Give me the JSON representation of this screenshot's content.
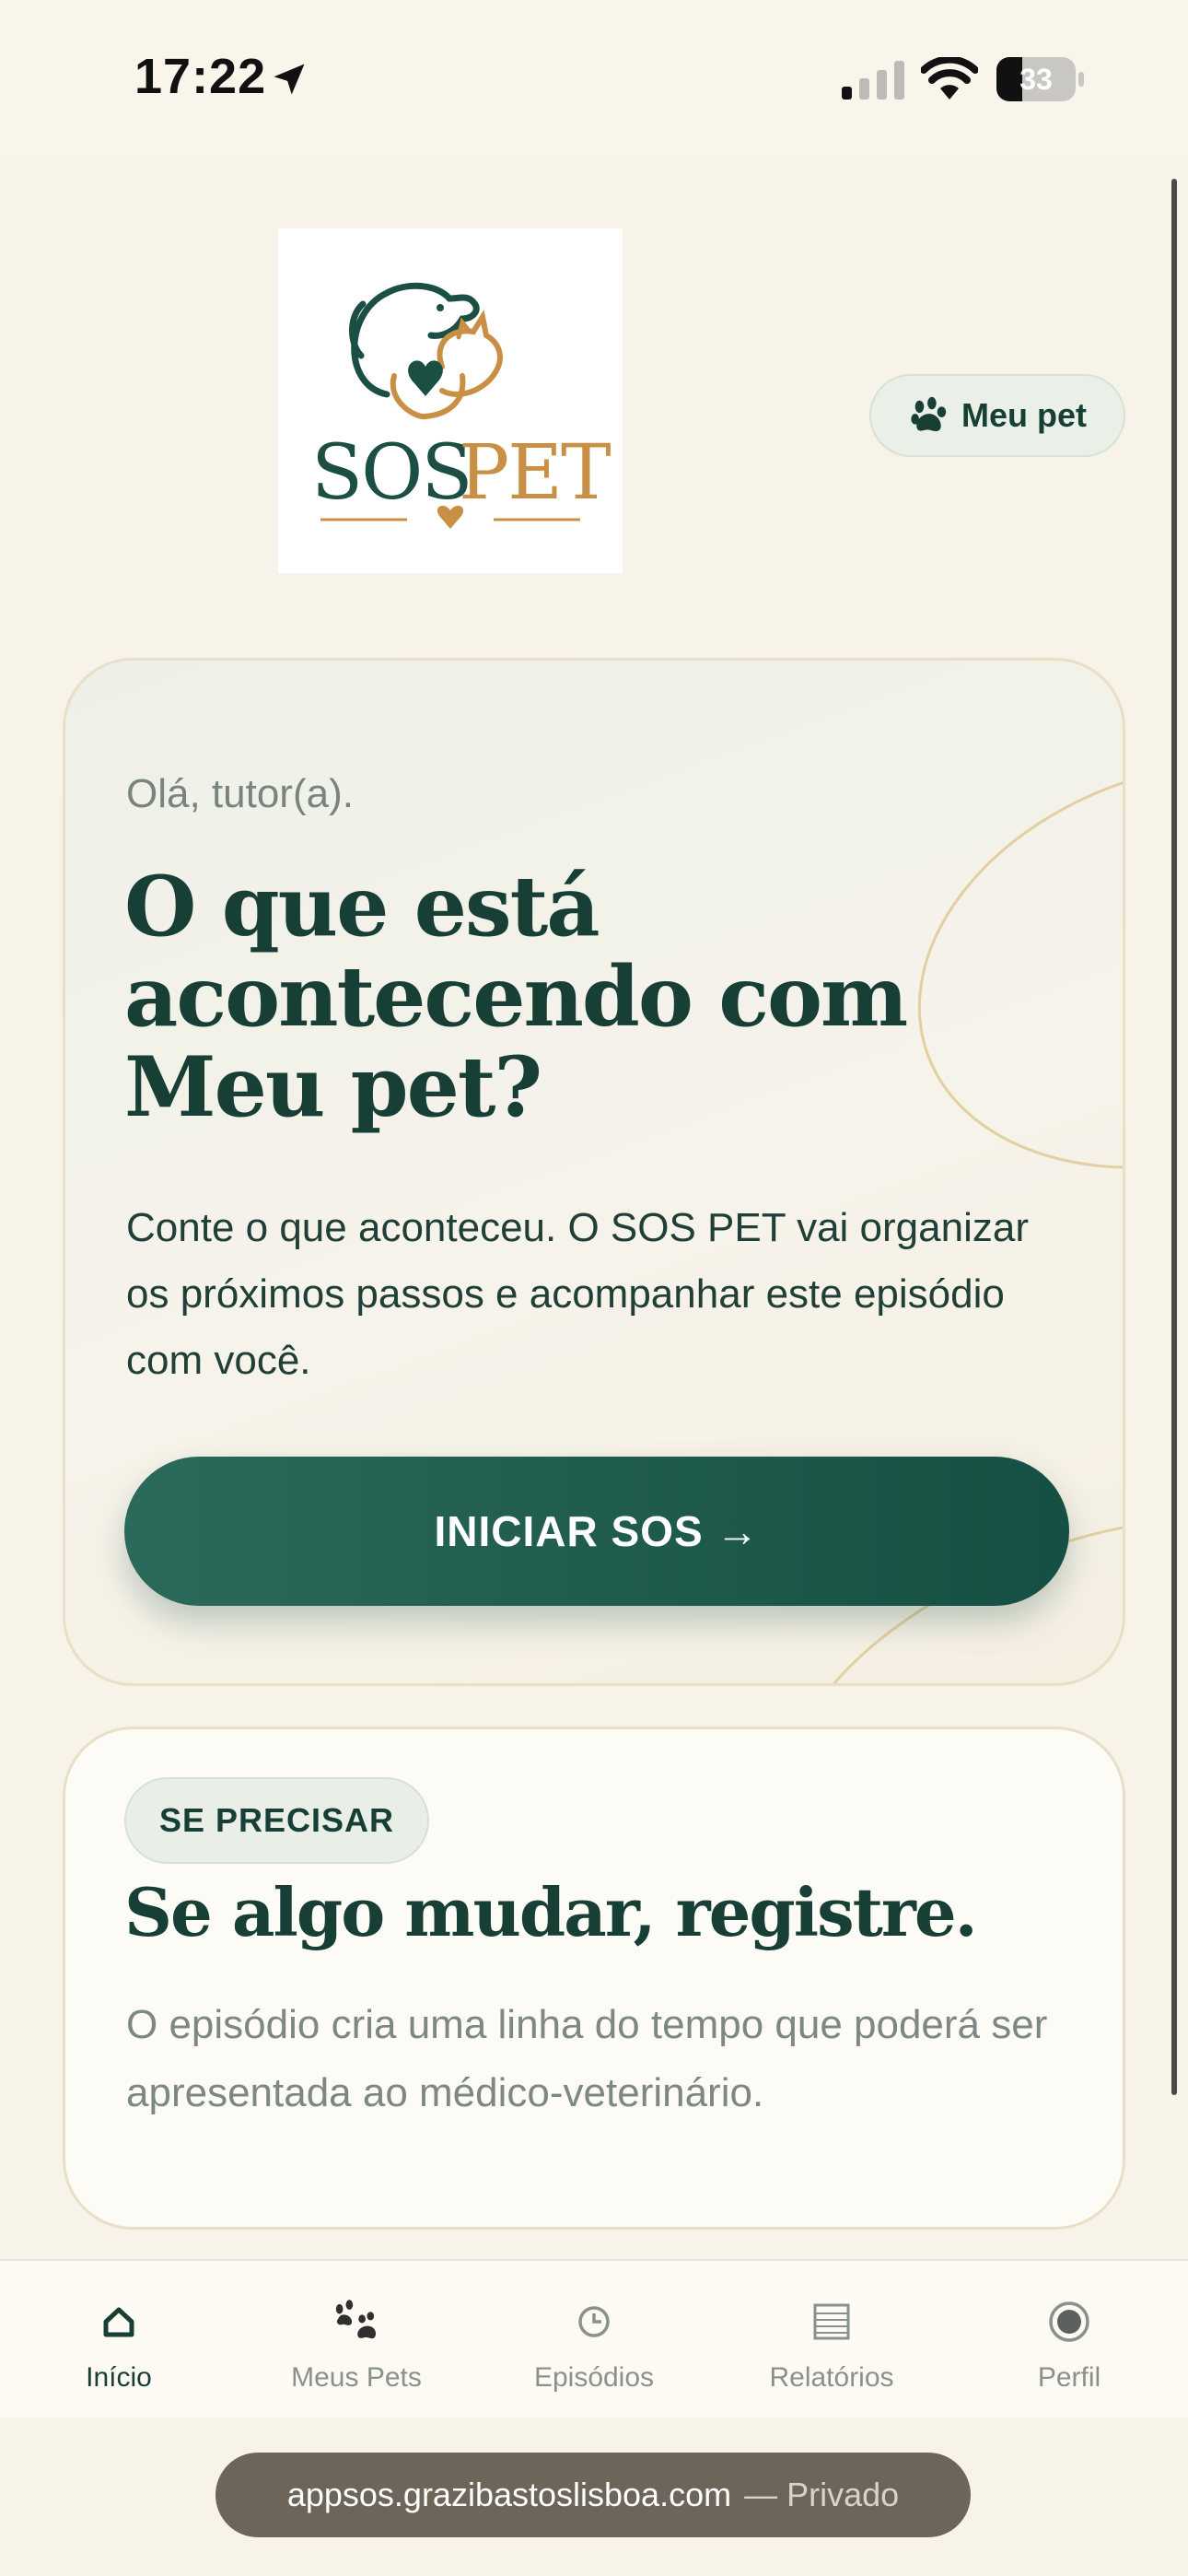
{
  "status_bar": {
    "time": "17:22",
    "battery": "33",
    "battery_level": 0.33
  },
  "header": {
    "meu_pet_label": "Meu pet"
  },
  "logo": {
    "sos": "SOS",
    "pet": "PET"
  },
  "hero": {
    "greeting": "Olá, tutor(a).",
    "title": "O que está acontecendo com Meu pet?",
    "description": "Conte o que aconteceu. O SOS PET vai organizar os próximos passos e acompanhar este episódio com você.",
    "cta_label": "INICIAR SOS →"
  },
  "info": {
    "badge": "SE PRECISAR",
    "title": "Se algo mudar, registre.",
    "description": "O episódio cria uma linha do tempo que poderá ser apresentada ao médico-veterinário."
  },
  "nav": {
    "items": [
      {
        "label": "Início",
        "icon": "home-icon",
        "active": true
      },
      {
        "label": "Meus Pets",
        "icon": "paw-icon",
        "active": false
      },
      {
        "label": "Episódios",
        "icon": "clock-icon",
        "active": false
      },
      {
        "label": "Relatórios",
        "icon": "report-icon",
        "active": false
      },
      {
        "label": "Perfil",
        "icon": "profile-icon",
        "active": false
      }
    ]
  },
  "browser": {
    "host": "appsos.grazibastoslisboa.com",
    "mode": "— Privado"
  },
  "colors": {
    "primary": "#173f35",
    "accent": "#c99045",
    "background": "#f8f3e8"
  }
}
